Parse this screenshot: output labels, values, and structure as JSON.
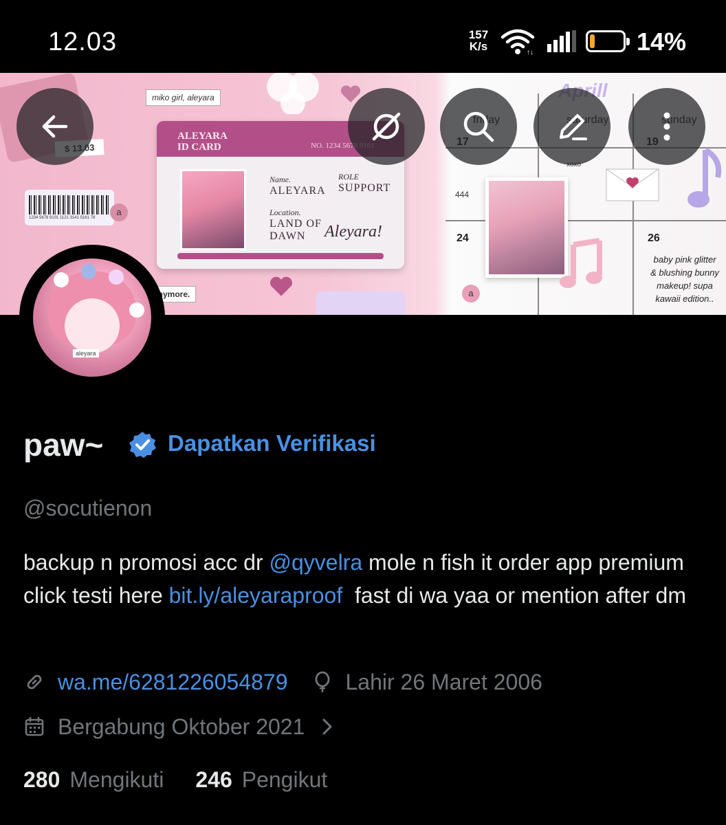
{
  "status_bar": {
    "time": "12.03",
    "net_speed_value": "157",
    "net_speed_unit": "K/s",
    "battery_percent": "14%",
    "battery_level": 0.14,
    "battery_color": "#ffa726"
  },
  "banner": {
    "id_card_title": "ALEYARA ID CARD",
    "id_card_title_line1": "ALEYARA",
    "id_card_title_line2": "ID CARD",
    "id_card_no": "NO. 1234 5678 9101",
    "name_label": "Name.",
    "name_value": "ALEYARA",
    "role_label": "ROLE",
    "role_value": "SUPPORT",
    "location_label": "Location.",
    "location_value_line1": "LAND OF",
    "location_value_line2": "DAWN",
    "signature": "Aleyara!",
    "note_top": "miko girl, aleyara",
    "price_tag": "$ 13.03",
    "barcode_number": "1234 5678 9101 1121 3141 5161 78",
    "note_bottom": "te anymore.",
    "calendar_month": "Aprill",
    "calendar_days": [
      "friday",
      "saturday",
      "sunday"
    ],
    "calendar_numbers": [
      "17",
      "19",
      "24",
      "26"
    ],
    "calendar_scribble": "444",
    "calendar_xoxo": "xoxo",
    "calendar_note_line1": "baby pink glitter",
    "calendar_note_line2": "& blushing bunny",
    "calendar_note_line3": "makeup! supa",
    "calendar_note_line4": "kawaii edition..",
    "letter_a": "a"
  },
  "header_buttons": {
    "back": "back-arrow-icon",
    "grok": "grok-icon",
    "search": "search-icon",
    "edit": "edit-icon",
    "more": "more-vertical-icon"
  },
  "avatar": {
    "caption": "aleyara"
  },
  "profile": {
    "display_name": "paw~",
    "verification_cta": "Dapatkan Verifikasi",
    "handle": "@socutienon",
    "bio_part1": "backup n promosi acc dr ",
    "bio_mention": "@qyvelra",
    "bio_part2": " mole n fish it order app premium click testi here ",
    "bio_link": "bit.ly/aleyaraproof",
    "bio_part3": "  fast di wa yaa or mention after dm",
    "website": "wa.me/6281226054879",
    "birthday": "Lahir 26 Maret 2006",
    "joined": "Bergabung Oktober 2021",
    "following_count": "280",
    "following_label": "Mengikuti",
    "followers_count": "246",
    "followers_label": "Pengikut",
    "accent_color": "#4a90e2"
  }
}
